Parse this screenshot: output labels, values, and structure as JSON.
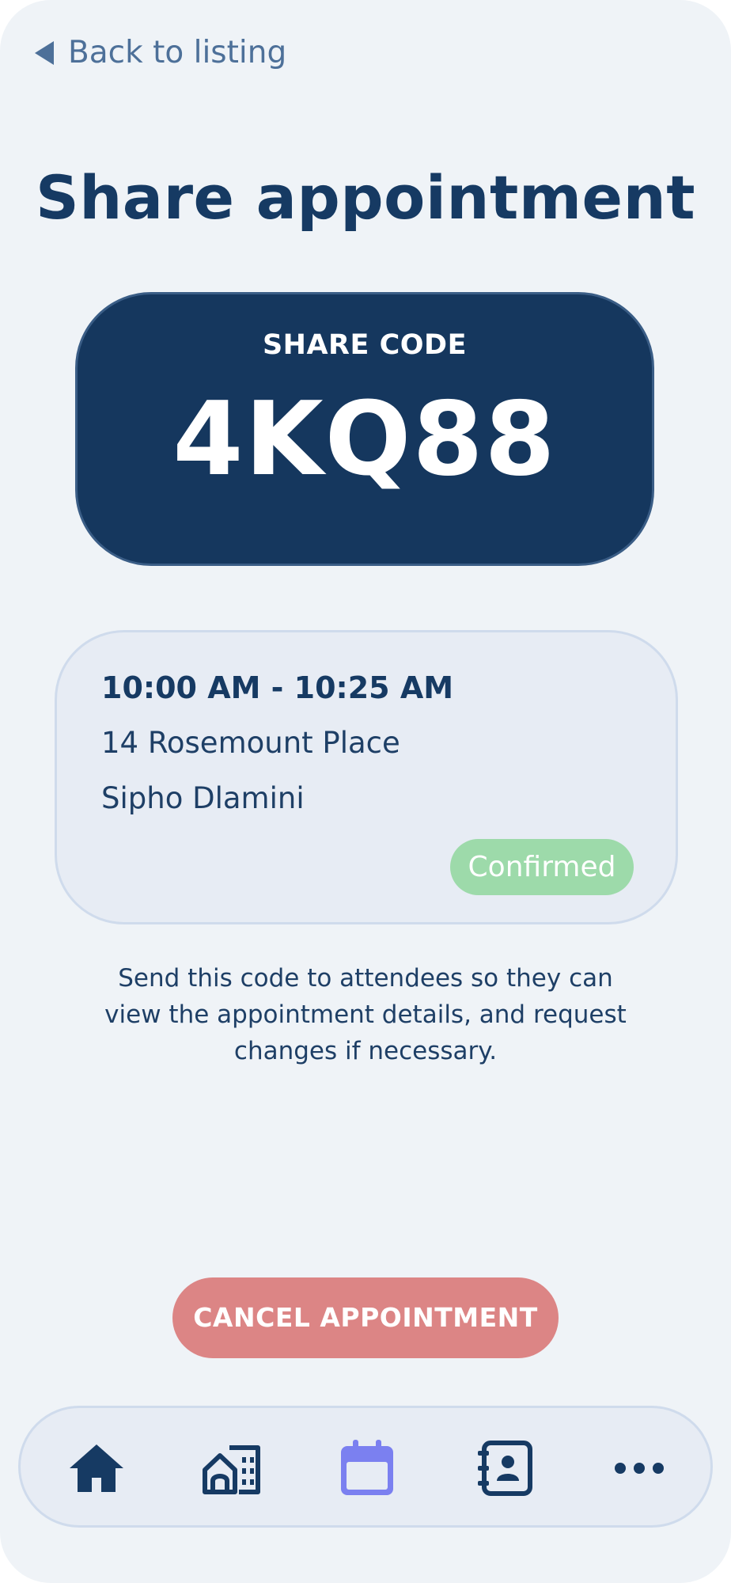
{
  "nav": {
    "back_label": "Back to listing"
  },
  "page": {
    "title": "Share appointment"
  },
  "share_code": {
    "label": "SHARE CODE",
    "code": "4KQ88"
  },
  "appointment": {
    "time_range": "10:00 AM - 10:25 AM",
    "address": "14 Rosemount Place",
    "attendee": "Sipho Dlamini",
    "status": "Confirmed"
  },
  "info": {
    "line1": "Send this code to attendees so they can",
    "line2": "view the appointment details, and request",
    "line3": "changes if necessary."
  },
  "actions": {
    "cancel_label": "CANCEL APPOINTMENT"
  },
  "tab_bar": {
    "items": [
      {
        "icon": "home-icon",
        "active": false
      },
      {
        "icon": "buildings-icon",
        "active": false
      },
      {
        "icon": "calendar-icon",
        "active": true
      },
      {
        "icon": "contacts-book-icon",
        "active": false
      },
      {
        "icon": "more-icon",
        "active": false
      }
    ]
  },
  "colors": {
    "primary": "#163a63",
    "code_card": "#15375e",
    "confirmed": "#9ddaaa",
    "cancel": "#dc8585",
    "active_tab": "#7b80f0",
    "background": "#eff3f7"
  }
}
